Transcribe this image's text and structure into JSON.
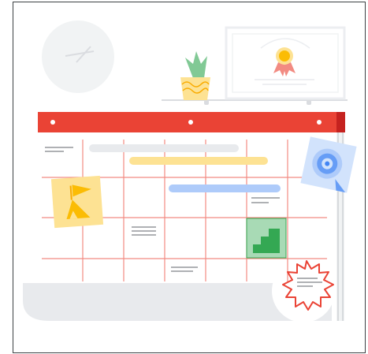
{
  "illustration": {
    "subject": "calendar-planning",
    "colors": {
      "header_bar": "#ea4335",
      "grid_line": "#ea4335",
      "gray_bar": "#e8eaed",
      "yellow_bar": "#fde293",
      "blue_bar": "#aecbfa",
      "green_tile": "#34a853",
      "flag_note": "#fde293",
      "flag_icon": "#fbbc04",
      "target_note": "#d2e3fc",
      "target_icon": "#4285f4",
      "badge": "#ea4335",
      "plant_leaf": "#81c995",
      "pot": "#fde293",
      "clock": "#f1f3f4",
      "base": "#e8eaed"
    },
    "icons": [
      "clock-icon",
      "plant-icon",
      "certificate-icon",
      "flag-note-icon",
      "stairs-icon",
      "target-icon",
      "seal-badge-icon"
    ]
  }
}
